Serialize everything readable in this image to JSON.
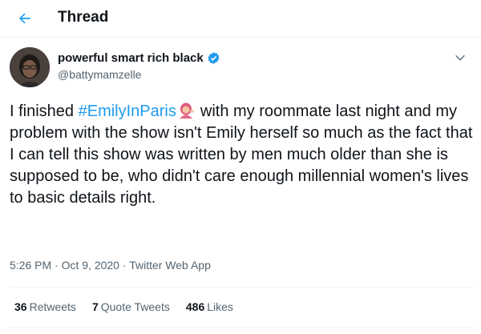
{
  "header": {
    "title": "Thread",
    "back_icon": "arrow-left-icon",
    "accent": "#1d9bf0"
  },
  "author": {
    "display_name": "powerful smart rich black",
    "handle": "@battymamzelle",
    "verified_icon": "verified-badge-icon"
  },
  "tweet": {
    "text_before": "I finished ",
    "hashtag": "#EmilyInParis",
    "emoji_icon": "woman-tipping-hand-emoji",
    "text_after": "with my roommate last night and my problem with the show isn't Emily herself so much as the fact that I can tell this show was written by men much older than she is supposed to be, who didn't care enough millennial women's lives to basic details right."
  },
  "meta": {
    "time": "5:26 PM",
    "date": "Oct 9, 2020",
    "source": "Twitter Web App"
  },
  "stats": {
    "retweets_count": "36",
    "retweets_label": "Retweets",
    "quotes_count": "7",
    "quotes_label": "Quote Tweets",
    "likes_count": "486",
    "likes_label": "Likes"
  }
}
